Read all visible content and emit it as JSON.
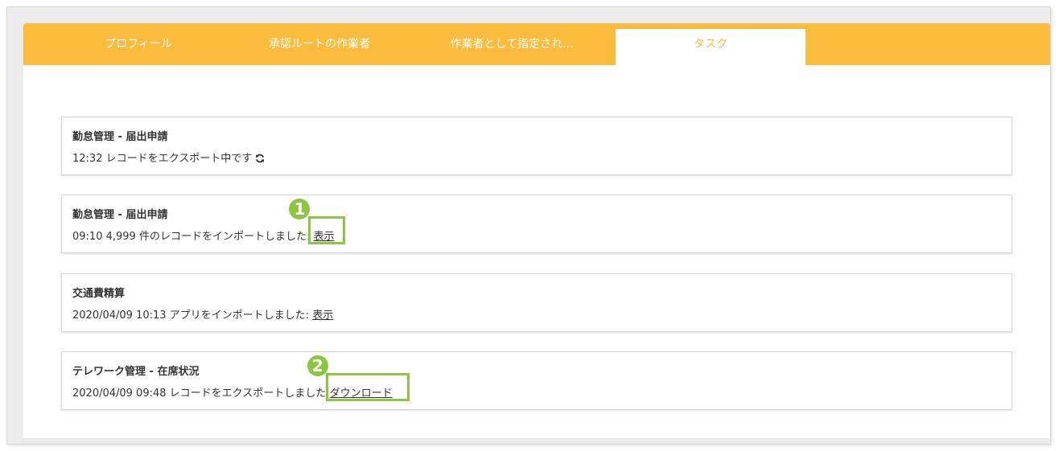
{
  "tabs": [
    {
      "label": "プロフィール"
    },
    {
      "label": "承認ルートの作業者"
    },
    {
      "label": "作業者として指定され..."
    },
    {
      "label": "タスク"
    }
  ],
  "active_tab": "タスク",
  "colors": {
    "accent": "#fbbb3c",
    "annotation": "#8cc63f"
  },
  "tasks": [
    {
      "title": "勤怠管理 - 届出申請",
      "message": "12:32 レコードをエクスポート中です",
      "status_icon": "sync-icon"
    },
    {
      "title": "勤怠管理 - 届出申請",
      "message": "09:10 4,999 件のレコードをインポートしました:",
      "link": "表示",
      "annotation": "1"
    },
    {
      "title": "交通費精算",
      "message": "2020/04/09 10:13 アプリをインポートしました:",
      "link": "表示"
    },
    {
      "title": "テレワーク管理 - 在席状況",
      "message": "2020/04/09 09:48 レコードをエクスポートしました:",
      "link": "ダウンロード",
      "annotation": "2"
    }
  ]
}
